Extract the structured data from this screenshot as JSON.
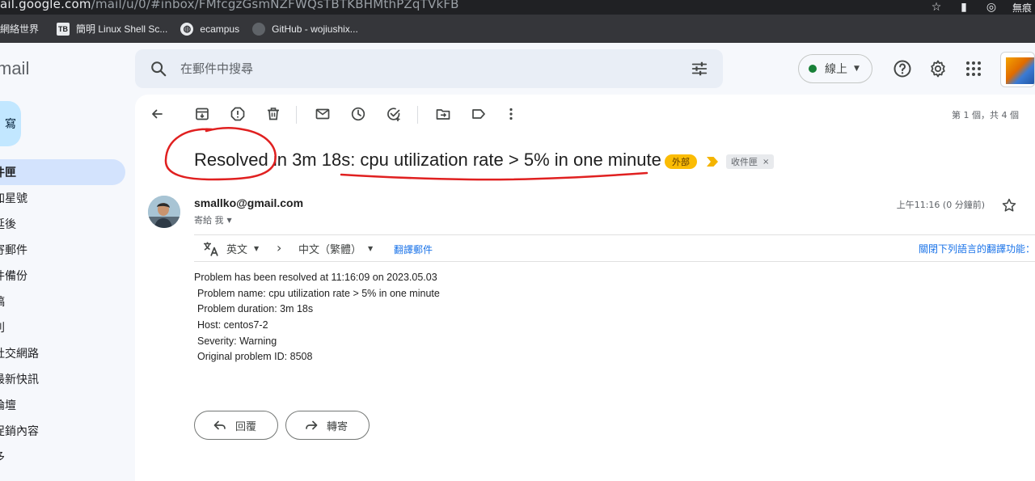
{
  "browser": {
    "url_host": "ail.google.com",
    "url_path": "/mail/u/0/#inbox/FMfcgzGsmNZFWQsTBTKBHMthPZqTVkFB",
    "profile_label": "無痕",
    "bookmarks": [
      {
        "label": "網絡世界",
        "icon": "bookmark-icon"
      },
      {
        "label": "簡明 Linux Shell Sc...",
        "icon": "tb-icon"
      },
      {
        "label": "ecampus",
        "icon": "globe-icon"
      },
      {
        "label": "GitHub - wojiushix...",
        "icon": "github-icon"
      }
    ]
  },
  "gmail": {
    "logo_text": "mail",
    "search_placeholder": "在郵件中搜尋",
    "status_label": "線上",
    "status_color": "#188038"
  },
  "sidebar": {
    "compose_label": "寫",
    "items": [
      {
        "label": "件匣",
        "active": true
      },
      {
        "label": "加星號"
      },
      {
        "label": "延後"
      },
      {
        "label": "寄郵件"
      },
      {
        "label": "件備份"
      },
      {
        "label": "稿"
      },
      {
        "label": "別"
      },
      {
        "label": "社交網路"
      },
      {
        "label": "最新快訊"
      },
      {
        "label": "論壇"
      },
      {
        "label": "促銷內容"
      },
      {
        "label": "多"
      }
    ]
  },
  "toolbar": {
    "counter": "第 1 個，共 4 個"
  },
  "message": {
    "subject": "Resolved in 3m 18s: cpu utilization rate > 5% in one minute",
    "external_badge": "外部",
    "label_chip": "收件匣",
    "label_close": "×",
    "sender": "smallko@gmail.com",
    "to_line": "寄給 我",
    "time": "上午11:16 (0 分鐘前)",
    "translate": {
      "from": "英文",
      "to": "中文（繁體）",
      "link": "翻譯郵件",
      "turn_off": "關閉下列語言的翻譯功能："
    },
    "body_lines": [
      "Problem has been resolved at 11:16:09 on 2023.05.03",
      "Problem name: cpu utilization rate > 5% in one minute",
      "Problem duration: 3m 18s",
      "Host: centos7-2",
      "Severity: Warning",
      "Original problem ID: 8508"
    ],
    "reply_label": "回覆",
    "forward_label": "轉寄"
  },
  "colors": {
    "accent": "#1a73e8",
    "badge": "#fbbc04",
    "annotation": "#e02020"
  }
}
